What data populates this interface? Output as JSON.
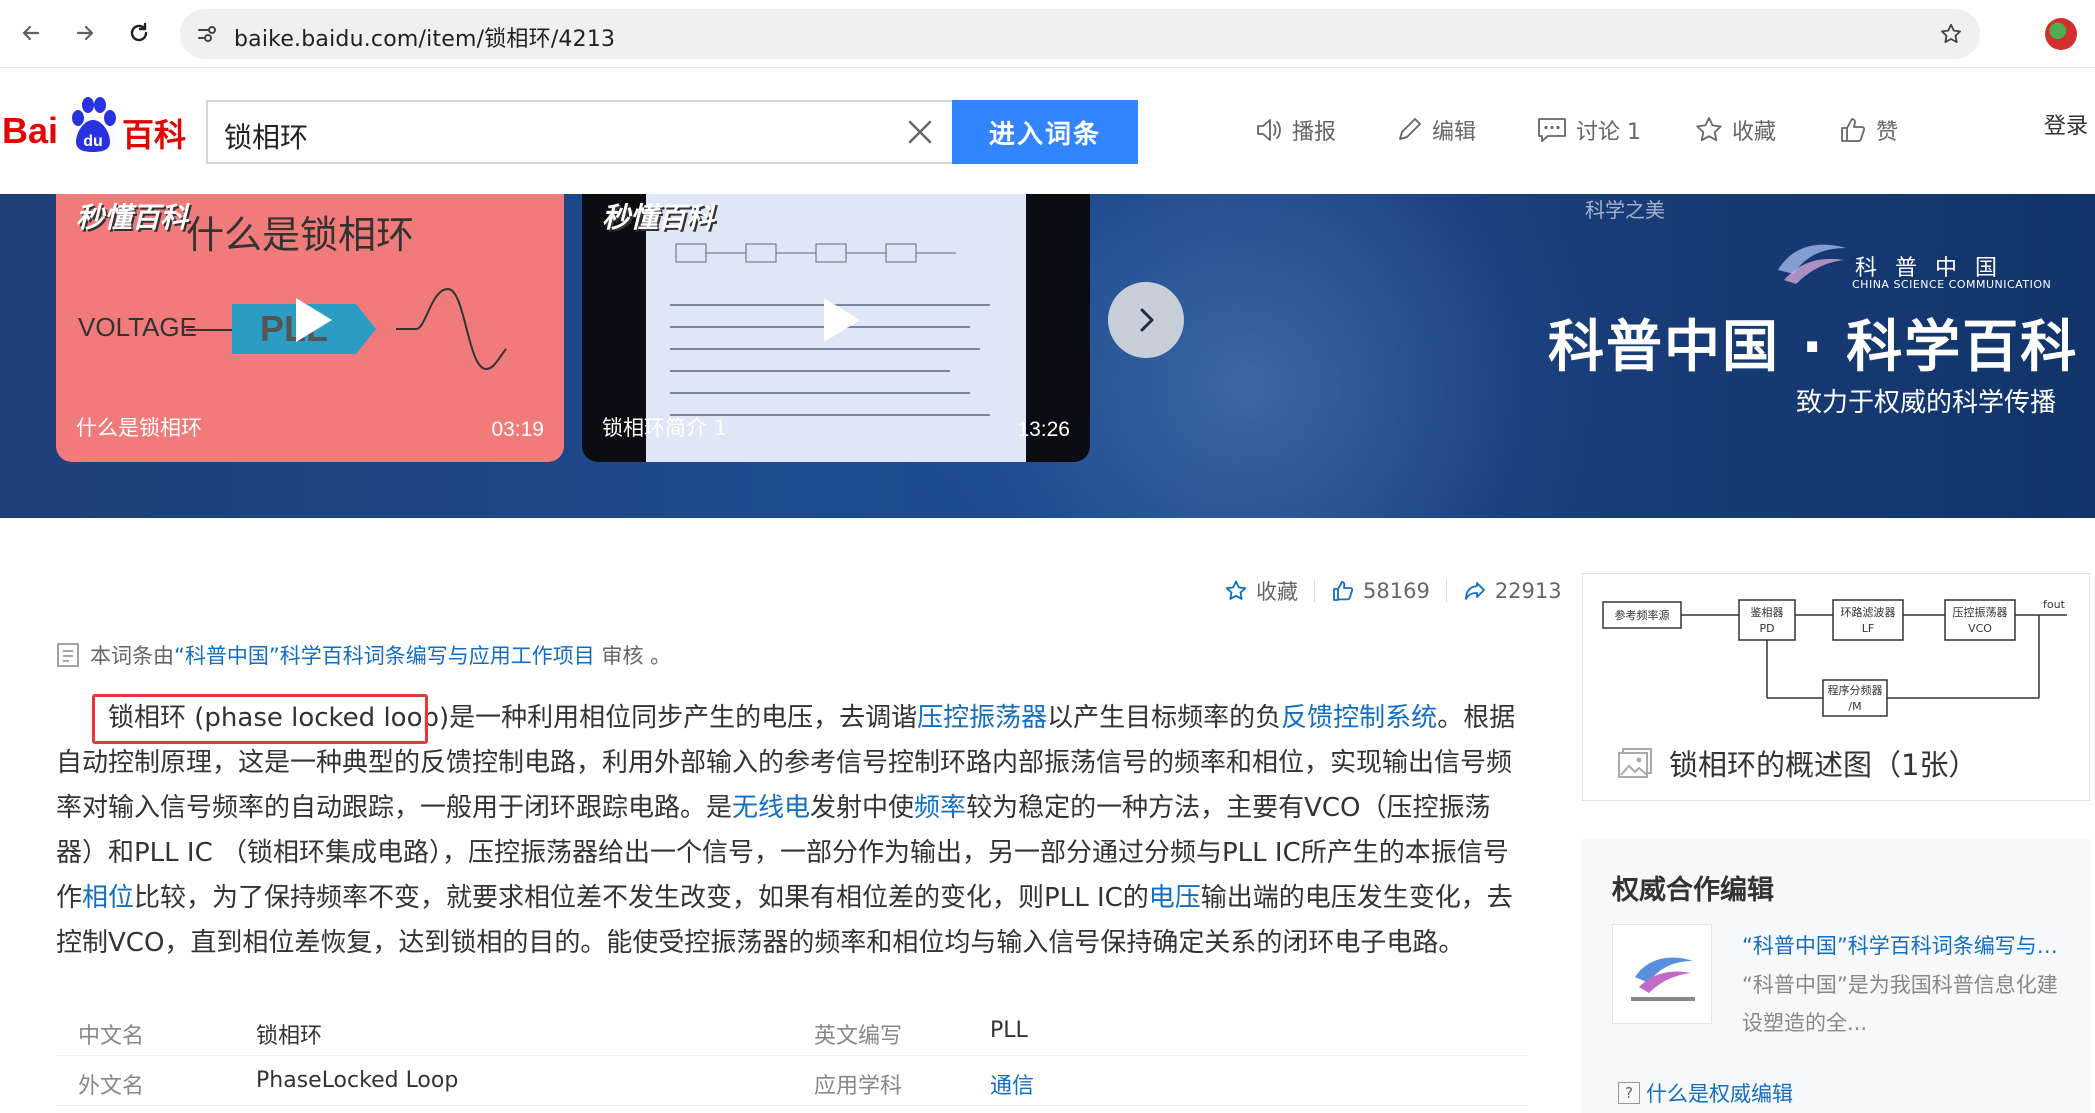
{
  "browser": {
    "url": "baike.baidu.com/item/锁相环/4213"
  },
  "header": {
    "logo_bai": "Bai",
    "logo_du": "du",
    "logo_baike": "百科",
    "search_value": "锁相环",
    "search_button": "进入词条",
    "tools": {
      "broadcast": "播报",
      "edit": "编辑",
      "discuss": "讨论 1",
      "favorite": "收藏",
      "like": "赞"
    },
    "login": "登录"
  },
  "banner": {
    "videos": [
      {
        "brand": "秒懂百科",
        "slide_title": "什么是锁相环",
        "voltage": "VOLTAGE",
        "pll": "PLL",
        "caption": "什么是锁相环",
        "duration": "03:19"
      },
      {
        "brand": "秒懂百科",
        "caption": "锁相环简介 1",
        "duration": "13:26"
      }
    ],
    "partner_top": "科学之美",
    "partner_cn": "科普中国",
    "partner_en": "CHINA SCIENCE COMMUNICATION",
    "partner_title": "科普中国 · 科学百科",
    "partner_slogan": "致力于权威的科学传播"
  },
  "stats": {
    "favorite": "收藏",
    "likes": "58169",
    "shares": "22913"
  },
  "audit": {
    "prefix": "本词条由",
    "link": "“科普中国”科学百科词条编写与应用工作项目",
    "suffix": " 审核 。"
  },
  "summary": {
    "s1": "锁相环 (phase locked loop)是一种利用相位同步产生的电压，去调谐",
    "l1": "压控振荡器",
    "s2": "以产生目标频率的负",
    "l2": "反馈控制系统",
    "s3": "。根据自动控制原理，这是一种典型的反馈控制电路，利用外部输入的参考信号控制环路内部振荡信号的频率和相位，实现输出信号频率对输入信号频率的自动跟踪，一般用于闭环跟踪电路。是",
    "l3": "无线电",
    "s4": "发射中使",
    "l4": "频率",
    "s5": "较为稳定的一种方法，主要有VCO（压控振荡器）和PLL IC （锁相环集成电路），压控振荡器给出一个信号，一部分作为输出，另一部分通过分频与PLL IC所产生的本振信号作",
    "l5": "相位",
    "s6": "比较，为了保持频率不变，就要求相位差不发生改变，如果有相位差的变化，则PLL IC的",
    "l6": "电压",
    "s7": "输出端的电压发生变化，去控制VCO，直到相位差恢复，达到锁相的目的。能使受控振荡器的频率和相位均与输入信号保持确定关系的闭环电子电路。"
  },
  "info_table": [
    {
      "label1": "中文名",
      "value1": "锁相环",
      "label2": "英文编写",
      "value2": "PLL"
    },
    {
      "label1": "外文名",
      "value1": "PhaseLocked Loop",
      "label2": "应用学科",
      "value2": "通信"
    }
  ],
  "album": {
    "caption": "锁相环的概述图（1张）",
    "diagram": {
      "ref": "参考频率源",
      "pd1": "鉴相器",
      "pd2": "PD",
      "lf1": "环路滤波器",
      "lf2": "LF",
      "vco1": "压控振荡器",
      "vco2": "VCO",
      "fout": "fout",
      "div1": "程序分频器",
      "div2": "/M"
    }
  },
  "authority": {
    "title": "权威合作编辑",
    "name": "“科普中国”科学百科词条编写与应用工作项目",
    "description": "“科普中国”是为我国科普信息化建设塑造的全...",
    "help": "什么是权威编辑"
  },
  "colors": {
    "brand_red": "#e10602",
    "search_blue": "#3385ff",
    "link_blue": "#136ec2",
    "highlight_red": "#e53935"
  }
}
